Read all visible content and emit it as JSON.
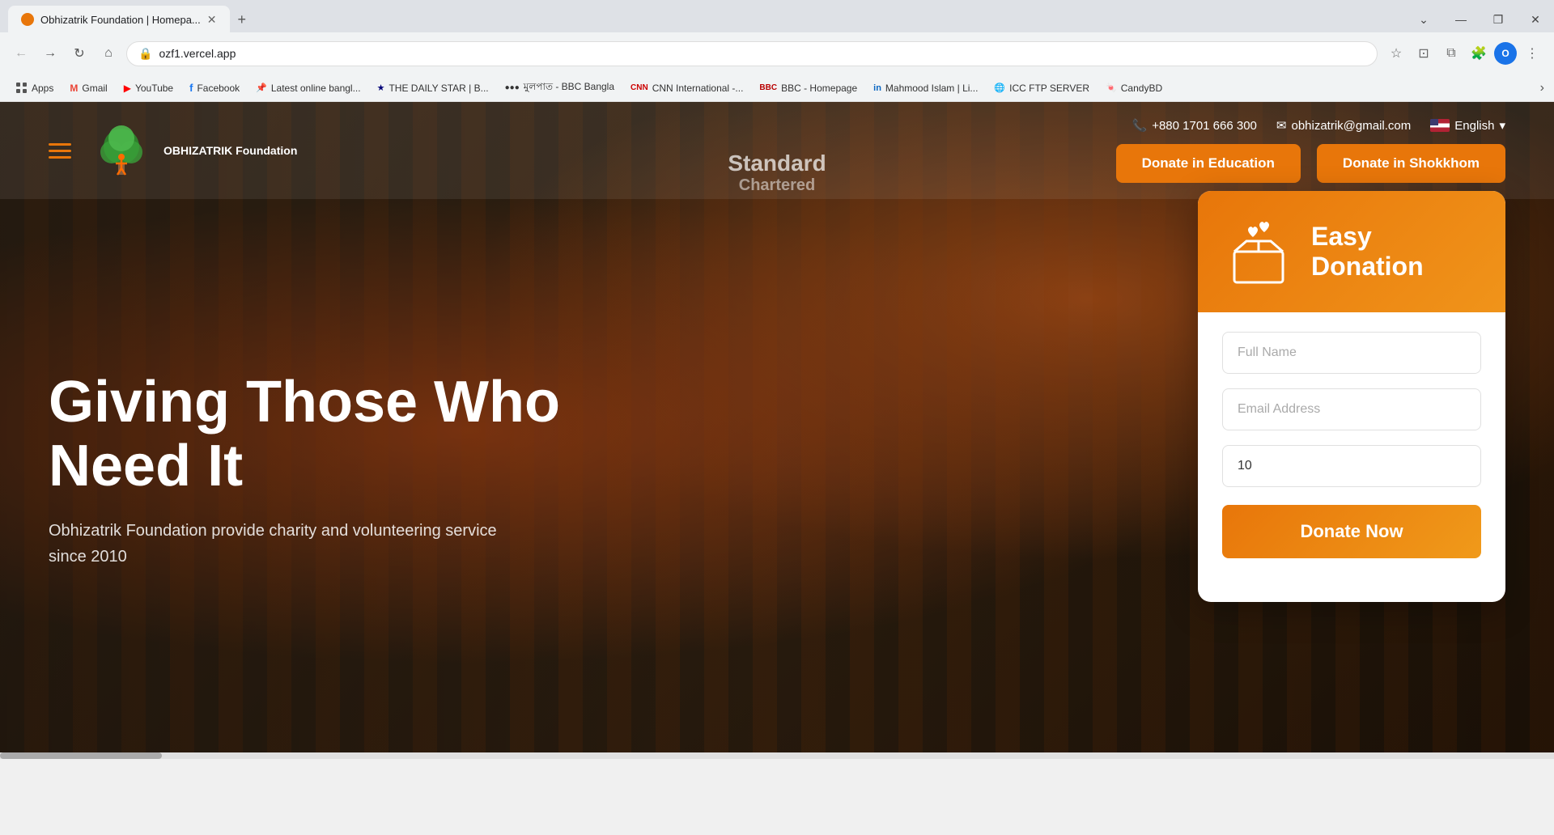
{
  "browser": {
    "tab": {
      "title": "Obhizatrik Foundation | Homepa...",
      "favicon_color": "#e8760a"
    },
    "url": "ozf1.vercel.app",
    "window_controls": {
      "minimize": "—",
      "maximize": "❐",
      "close": "✕"
    },
    "bookmarks": [
      {
        "label": "Apps",
        "icon": "apps"
      },
      {
        "label": "Gmail",
        "icon": "gmail"
      },
      {
        "label": "YouTube",
        "icon": "youtube"
      },
      {
        "label": "Facebook",
        "icon": "facebook"
      },
      {
        "label": "Latest online bangl...",
        "icon": "bookmark"
      },
      {
        "label": "THE DAILY STAR | B...",
        "icon": "bookmark"
      },
      {
        "label": "মুলপাত - BBC Bangla",
        "icon": "bookmark"
      },
      {
        "label": "CNN International -...",
        "icon": "bookmark"
      },
      {
        "label": "BBC - Homepage",
        "icon": "bookmark"
      },
      {
        "label": "Mahmood Islam | Li...",
        "icon": "bookmark"
      },
      {
        "label": "ICC FTP SERVER",
        "icon": "bookmark"
      },
      {
        "label": "CandyBD",
        "icon": "bookmark"
      }
    ]
  },
  "navbar": {
    "logo_text": "OBHIZATRIK Foundation",
    "phone": "+880 1701 666 300",
    "email": "obhizatrik@gmail.com",
    "language": "English",
    "donate_education_label": "Donate in Education",
    "donate_shokkhom_label": "Donate in Shokkhom"
  },
  "hero": {
    "title": "Giving Those Who Need It",
    "subtitle": "Obhizatrik Foundation provide charity and volunteering service since 2010",
    "sc_watermark": "Standard",
    "sc_watermark2": "Chartered"
  },
  "donation_card": {
    "header_title": "Easy Donation",
    "form": {
      "full_name_placeholder": "Full Name",
      "email_placeholder": "Email Address",
      "amount_value": "10",
      "donate_btn_label": "Donate Now"
    }
  }
}
